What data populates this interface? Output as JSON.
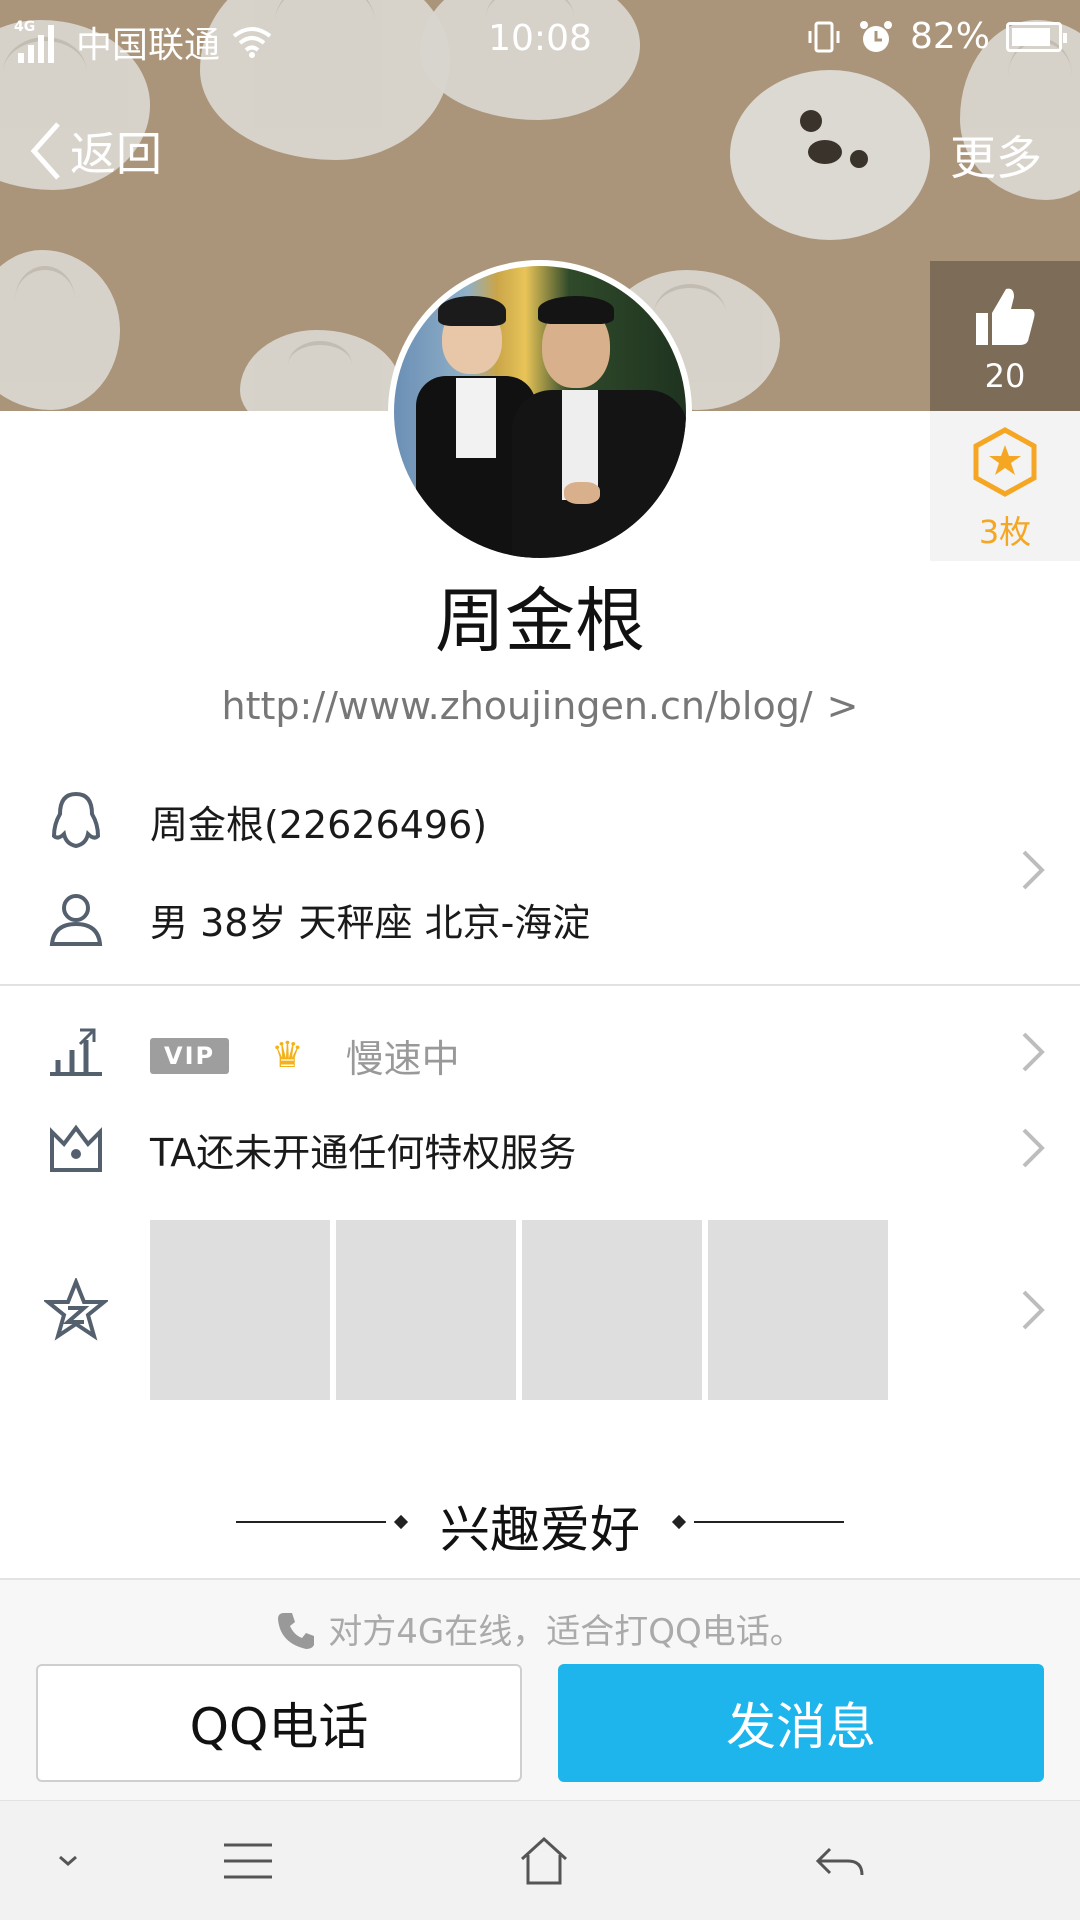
{
  "status_bar": {
    "network": "4G",
    "carrier": "中国联通",
    "time": "10:08",
    "battery": "82%",
    "icons": [
      "signal-icon",
      "wifi-icon",
      "vibrate-icon",
      "alarm-icon",
      "battery-icon"
    ]
  },
  "nav": {
    "back_label": "返回",
    "more_label": "更多"
  },
  "like": {
    "count": "20",
    "icon": "thumbs-up-icon"
  },
  "badge": {
    "count": "3枚",
    "icon": "star-badge-icon"
  },
  "profile": {
    "name": "周金根",
    "url": "http://www.zhoujingen.cn/blog/"
  },
  "info": {
    "qq": "周金根(22626496)",
    "details": "男  38岁  天秤座  北京-海淀"
  },
  "vip": {
    "tag": "VIP",
    "status": "慢速中",
    "privilege": "TA还未开通任何特权服务"
  },
  "section": {
    "title": "兴趣爱好"
  },
  "action": {
    "hint": "对方4G在线，适合打QQ电话。",
    "call_label": "QQ电话",
    "message_label": "发消息"
  },
  "colors": {
    "cover_bg": "#ab957a",
    "primary_button": "#1eb4ec",
    "badge_gold": "#f5a623"
  }
}
